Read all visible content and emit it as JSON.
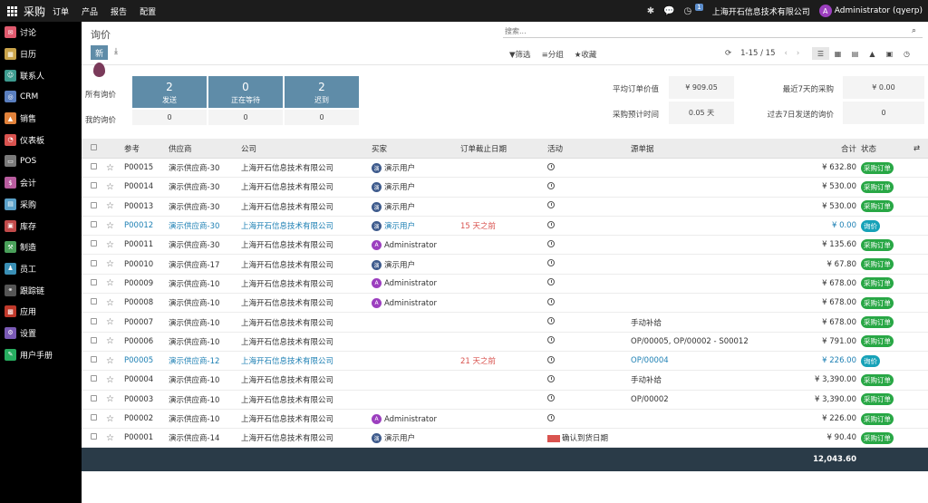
{
  "topbar": {
    "app_name": "采购",
    "menu": [
      "订单",
      "产品",
      "报告",
      "配置"
    ],
    "company": "上海开石信息技术有限公司",
    "user": "Administrator (qyerp)",
    "user_initial": "A",
    "activity_count": "1"
  },
  "sidebar": {
    "items": [
      {
        "label": "讨论",
        "icon": "discuss-icon",
        "color": "#e05a6e"
      },
      {
        "label": "日历",
        "icon": "calendar-icon",
        "color": "#c9a34a"
      },
      {
        "label": "联系人",
        "icon": "contacts-icon",
        "color": "#3d9b8f"
      },
      {
        "label": "CRM",
        "icon": "crm-icon",
        "color": "#5a7fbf"
      },
      {
        "label": "销售",
        "icon": "sales-icon",
        "color": "#e2823a"
      },
      {
        "label": "仪表板",
        "icon": "dashboard-icon",
        "color": "#d9534f"
      },
      {
        "label": "POS",
        "icon": "pos-icon",
        "color": "#7a7a7a"
      },
      {
        "label": "会计",
        "icon": "accounting-icon",
        "color": "#b85c9e"
      },
      {
        "label": "采购",
        "icon": "purchase-icon",
        "color": "#5aa0c8"
      },
      {
        "label": "库存",
        "icon": "inventory-icon",
        "color": "#c14a4a"
      },
      {
        "label": "制造",
        "icon": "manufacturing-icon",
        "color": "#4aa05a"
      },
      {
        "label": "员工",
        "icon": "employees-icon",
        "color": "#3a8fb5"
      },
      {
        "label": "跟踪链",
        "icon": "link-tracker-icon",
        "color": "#555555"
      },
      {
        "label": "应用",
        "icon": "apps-icon",
        "color": "#c0392b"
      },
      {
        "label": "设置",
        "icon": "settings-icon",
        "color": "#7a5ab5"
      },
      {
        "label": "用户手册",
        "icon": "manual-icon",
        "color": "#27ae60"
      }
    ]
  },
  "control": {
    "title": "询价",
    "new_label": "新",
    "search_placeholder": "搜索...",
    "filter_label": "筛选",
    "group_label": "分组",
    "favorite_label": "收藏",
    "pager": "1-15 / 15"
  },
  "dashboard": {
    "all_label": "所有询价",
    "my_label": "我的询价",
    "tiles": [
      {
        "count": "2",
        "label": "发送",
        "mine": "0"
      },
      {
        "count": "0",
        "label": "正在等待",
        "mine": "0"
      },
      {
        "count": "2",
        "label": "迟到",
        "mine": "0"
      }
    ],
    "kpis": {
      "avg_label": "平均订单价值",
      "avg_value": "¥ 909.05",
      "last7_label": "最近7天的采购",
      "last7_value": "¥ 0.00",
      "lead_label": "采购预计时间",
      "lead_value": "0.05 天",
      "sent_label": "过去7日发送的询价",
      "sent_value": "0"
    }
  },
  "table": {
    "headers": {
      "ref": "参考",
      "vendor": "供应商",
      "company": "公司",
      "buyer": "买家",
      "deadline": "订单截止日期",
      "activity": "活动",
      "source": "源单据",
      "total": "合计",
      "status": "状态"
    },
    "rows": [
      {
        "ref": "P00015",
        "vendor": "演示供应商-30",
        "company": "上海开石信息技术有限公司",
        "buyer": "演示用户",
        "buyer_type": "u",
        "deadline": "",
        "activity": "clock",
        "source": "",
        "total": "¥ 632.80",
        "status": "采购订单",
        "status_type": "g",
        "blue": false
      },
      {
        "ref": "P00014",
        "vendor": "演示供应商-30",
        "company": "上海开石信息技术有限公司",
        "buyer": "演示用户",
        "buyer_type": "u",
        "deadline": "",
        "activity": "clock",
        "source": "",
        "total": "¥ 530.00",
        "status": "采购订单",
        "status_type": "g",
        "blue": false
      },
      {
        "ref": "P00013",
        "vendor": "演示供应商-30",
        "company": "上海开石信息技术有限公司",
        "buyer": "演示用户",
        "buyer_type": "u",
        "deadline": "",
        "activity": "clock",
        "source": "",
        "total": "¥ 530.00",
        "status": "采购订单",
        "status_type": "g",
        "blue": false
      },
      {
        "ref": "P00012",
        "vendor": "演示供应商-30",
        "company": "上海开石信息技术有限公司",
        "buyer": "演示用户",
        "buyer_type": "u",
        "deadline": "15 天之前",
        "activity": "clock",
        "source": "",
        "total": "¥ 0.00",
        "status": "询价",
        "status_type": "b",
        "blue": true
      },
      {
        "ref": "P00011",
        "vendor": "演示供应商-30",
        "company": "上海开石信息技术有限公司",
        "buyer": "Administrator",
        "buyer_type": "a",
        "deadline": "",
        "activity": "clock",
        "source": "",
        "total": "¥ 135.60",
        "status": "采购订单",
        "status_type": "g",
        "blue": false
      },
      {
        "ref": "P00010",
        "vendor": "演示供应商-17",
        "company": "上海开石信息技术有限公司",
        "buyer": "演示用户",
        "buyer_type": "u",
        "deadline": "",
        "activity": "clock",
        "source": "",
        "total": "¥ 67.80",
        "status": "采购订单",
        "status_type": "g",
        "blue": false
      },
      {
        "ref": "P00009",
        "vendor": "演示供应商-10",
        "company": "上海开石信息技术有限公司",
        "buyer": "Administrator",
        "buyer_type": "a",
        "deadline": "",
        "activity": "clock",
        "source": "",
        "total": "¥ 678.00",
        "status": "采购订单",
        "status_type": "g",
        "blue": false
      },
      {
        "ref": "P00008",
        "vendor": "演示供应商-10",
        "company": "上海开石信息技术有限公司",
        "buyer": "Administrator",
        "buyer_type": "a",
        "deadline": "",
        "activity": "clock",
        "source": "",
        "total": "¥ 678.00",
        "status": "采购订单",
        "status_type": "g",
        "blue": false
      },
      {
        "ref": "P00007",
        "vendor": "演示供应商-10",
        "company": "上海开石信息技术有限公司",
        "buyer": "",
        "buyer_type": "",
        "deadline": "",
        "activity": "clock",
        "source": "手动补给",
        "total": "¥ 678.00",
        "status": "采购订单",
        "status_type": "g",
        "blue": false
      },
      {
        "ref": "P00006",
        "vendor": "演示供应商-10",
        "company": "上海开石信息技术有限公司",
        "buyer": "",
        "buyer_type": "",
        "deadline": "",
        "activity": "clock",
        "source": "OP/00005, OP/00002 - S00012",
        "total": "¥ 791.00",
        "status": "采购订单",
        "status_type": "g",
        "blue": false
      },
      {
        "ref": "P00005",
        "vendor": "演示供应商-12",
        "company": "上海开石信息技术有限公司",
        "buyer": "",
        "buyer_type": "",
        "deadline": "21 天之前",
        "activity": "clock",
        "source": "OP/00004",
        "total": "¥ 226.00",
        "status": "询价",
        "status_type": "b",
        "blue": true
      },
      {
        "ref": "P00004",
        "vendor": "演示供应商-10",
        "company": "上海开石信息技术有限公司",
        "buyer": "",
        "buyer_type": "",
        "deadline": "",
        "activity": "clock",
        "source": "手动补给",
        "total": "¥ 3,390.00",
        "status": "采购订单",
        "status_type": "g",
        "blue": false
      },
      {
        "ref": "P00003",
        "vendor": "演示供应商-10",
        "company": "上海开石信息技术有限公司",
        "buyer": "",
        "buyer_type": "",
        "deadline": "",
        "activity": "clock",
        "source": "OP/00002",
        "total": "¥ 3,390.00",
        "status": "采购订单",
        "status_type": "g",
        "blue": false
      },
      {
        "ref": "P00002",
        "vendor": "演示供应商-10",
        "company": "上海开石信息技术有限公司",
        "buyer": "Administrator",
        "buyer_type": "a",
        "deadline": "",
        "activity": "clock",
        "source": "",
        "total": "¥ 226.00",
        "status": "采购订单",
        "status_type": "g",
        "blue": false
      },
      {
        "ref": "P00001",
        "vendor": "演示供应商-14",
        "company": "上海开石信息技术有限公司",
        "buyer": "演示用户",
        "buyer_type": "u",
        "deadline": "",
        "activity": "确认到货日期",
        "source": "",
        "total": "¥ 90.40",
        "status": "采购订单",
        "status_type": "g",
        "blue": false
      }
    ],
    "grand_total": "12,043.60"
  }
}
